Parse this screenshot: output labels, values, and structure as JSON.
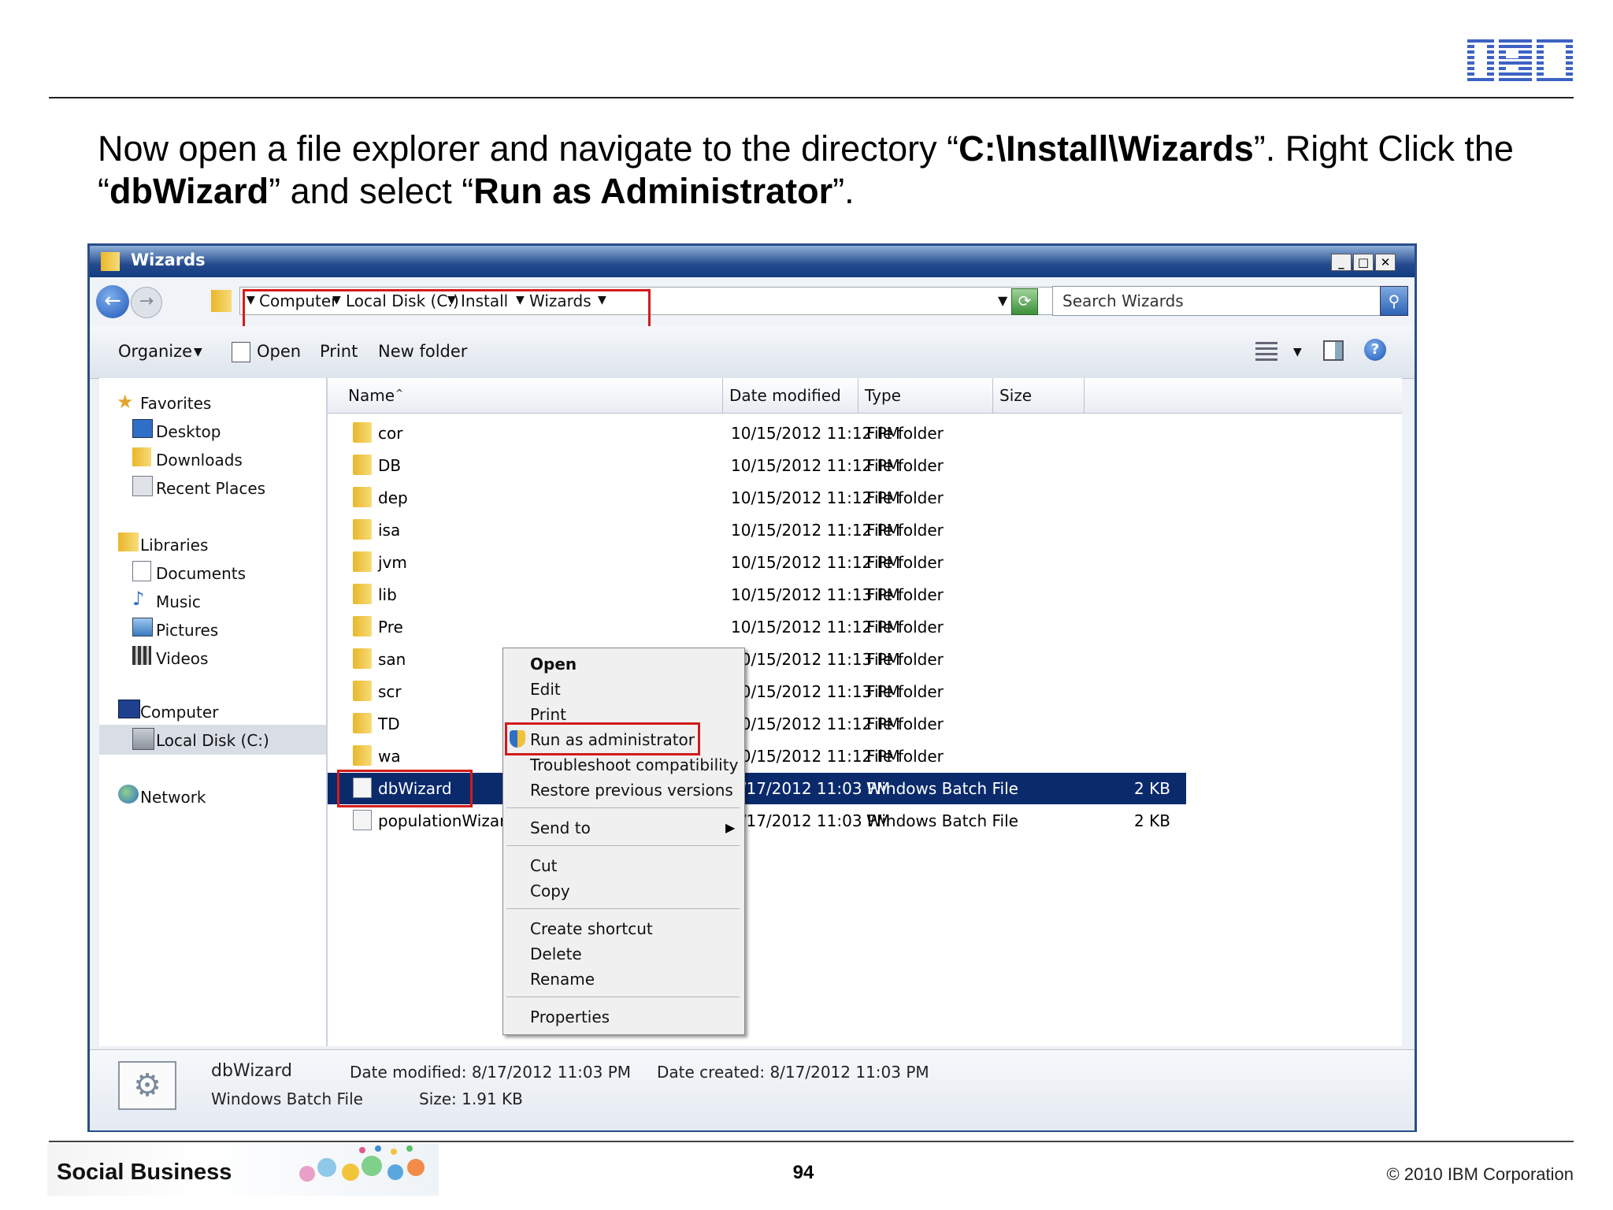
{
  "slide": {
    "instruction_part1": "Now open a file explorer and navigate to the directory “",
    "instruction_path": "C:\\Install\\Wizards",
    "instruction_part2": "”. Right Click the “",
    "instruction_file": "dbWizard",
    "instruction_part3": "” and select “",
    "instruction_action": "Run as Administrator",
    "instruction_part4": "”.",
    "page_number": "94",
    "copyright": "© 2010 IBM Corporation",
    "banner_label": "Social Business",
    "logo_text": "IBM"
  },
  "window": {
    "title": "Wizards",
    "minimize": "_",
    "maximize": "□",
    "close": "✕",
    "breadcrumb": [
      "Computer",
      "Local Disk (C:)",
      "Install",
      "Wizards"
    ],
    "search_placeholder": "Search Wizards"
  },
  "toolbar": {
    "organize": "Organize",
    "open": "Open",
    "print": "Print",
    "new_folder": "New folder"
  },
  "sidebar": {
    "favorites": "Favorites",
    "desktop": "Desktop",
    "downloads": "Downloads",
    "recent": "Recent Places",
    "libraries": "Libraries",
    "documents": "Documents",
    "music": "Music",
    "pictures": "Pictures",
    "videos": "Videos",
    "computer": "Computer",
    "local_disk": "Local Disk (C:)",
    "network": "Network"
  },
  "columns": {
    "name": "Name",
    "date": "Date modified",
    "type": "Type",
    "size": "Size"
  },
  "files": [
    {
      "name": "cor",
      "date": "10/15/2012 11:12 PM",
      "type": "File folder",
      "size": ""
    },
    {
      "name": "DB",
      "date": "10/15/2012 11:12 PM",
      "type": "File folder",
      "size": ""
    },
    {
      "name": "dep",
      "date": "10/15/2012 11:12 PM",
      "type": "File folder",
      "size": ""
    },
    {
      "name": "isa",
      "date": "10/15/2012 11:12 PM",
      "type": "File folder",
      "size": ""
    },
    {
      "name": "jvm",
      "date": "10/15/2012 11:12 PM",
      "type": "File folder",
      "size": ""
    },
    {
      "name": "lib",
      "date": "10/15/2012 11:13 PM",
      "type": "File folder",
      "size": ""
    },
    {
      "name": "Pre",
      "date": "10/15/2012 11:12 PM",
      "type": "File folder",
      "size": ""
    },
    {
      "name": "san",
      "date": "10/15/2012 11:13 PM",
      "type": "File folder",
      "size": ""
    },
    {
      "name": "scr",
      "date": "10/15/2012 11:13 PM",
      "type": "File folder",
      "size": ""
    },
    {
      "name": "TD",
      "date": "10/15/2012 11:12 PM",
      "type": "File folder",
      "size": ""
    },
    {
      "name": "wa",
      "date": "10/15/2012 11:12 PM",
      "type": "File folder",
      "size": ""
    },
    {
      "name": "dbWizard",
      "date": "8/17/2012 11:03 PM",
      "type": "Windows Batch File",
      "size": "2 KB"
    },
    {
      "name": "populationWizard",
      "date": "8/17/2012 11:03 PM",
      "type": "Windows Batch File",
      "size": "2 KB"
    }
  ],
  "context_menu": {
    "open": "Open",
    "edit": "Edit",
    "print": "Print",
    "run_admin": "Run as administrator",
    "troubleshoot": "Troubleshoot compatibility",
    "restore": "Restore previous versions",
    "send_to": "Send to",
    "cut": "Cut",
    "copy": "Copy",
    "create_shortcut": "Create shortcut",
    "delete": "Delete",
    "rename": "Rename",
    "properties": "Properties"
  },
  "status": {
    "name": "dbWizard",
    "type": "Windows Batch File",
    "date_modified": "Date modified: 8/17/2012 11:03 PM",
    "date_created": "Date created: 8/17/2012 11:03 PM",
    "size": "Size: 1.91 KB"
  },
  "colors": {
    "highlight": "#d21b1b",
    "selection": "#0a2a6b",
    "titlebar": "#244a8d",
    "ibm_blue": "#3d62c4"
  }
}
